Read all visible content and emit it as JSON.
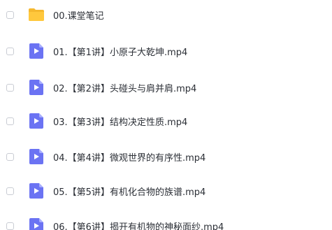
{
  "files": [
    {
      "name": "00.课堂笔记",
      "type": "folder",
      "icon": "folder-icon"
    },
    {
      "name": "01.【第1讲】小原子大乾坤.mp4",
      "type": "video",
      "icon": "video-file-icon"
    },
    {
      "name": "02.【第2讲】头碰头与肩并肩.mp4",
      "type": "video",
      "icon": "video-file-icon"
    },
    {
      "name": "03.【第3讲】结构决定性质.mp4",
      "type": "video",
      "icon": "video-file-icon"
    },
    {
      "name": "04.【第4讲】微观世界的有序性.mp4",
      "type": "video",
      "icon": "video-file-icon"
    },
    {
      "name": "05.【第5讲】有机化合物的族谱.mp4",
      "type": "video",
      "icon": "video-file-icon"
    },
    {
      "name": "06.【第6讲】揭开有机物的神秘面纱.mp4",
      "type": "video",
      "icon": "video-file-icon"
    }
  ],
  "colors": {
    "folder": "#ffc83d",
    "folder_tab": "#f5b82e",
    "video": "#6b73f3",
    "video_fold": "#a8aeff",
    "text": "#2b2f36",
    "checkbox_border": "#c9ccd3"
  }
}
